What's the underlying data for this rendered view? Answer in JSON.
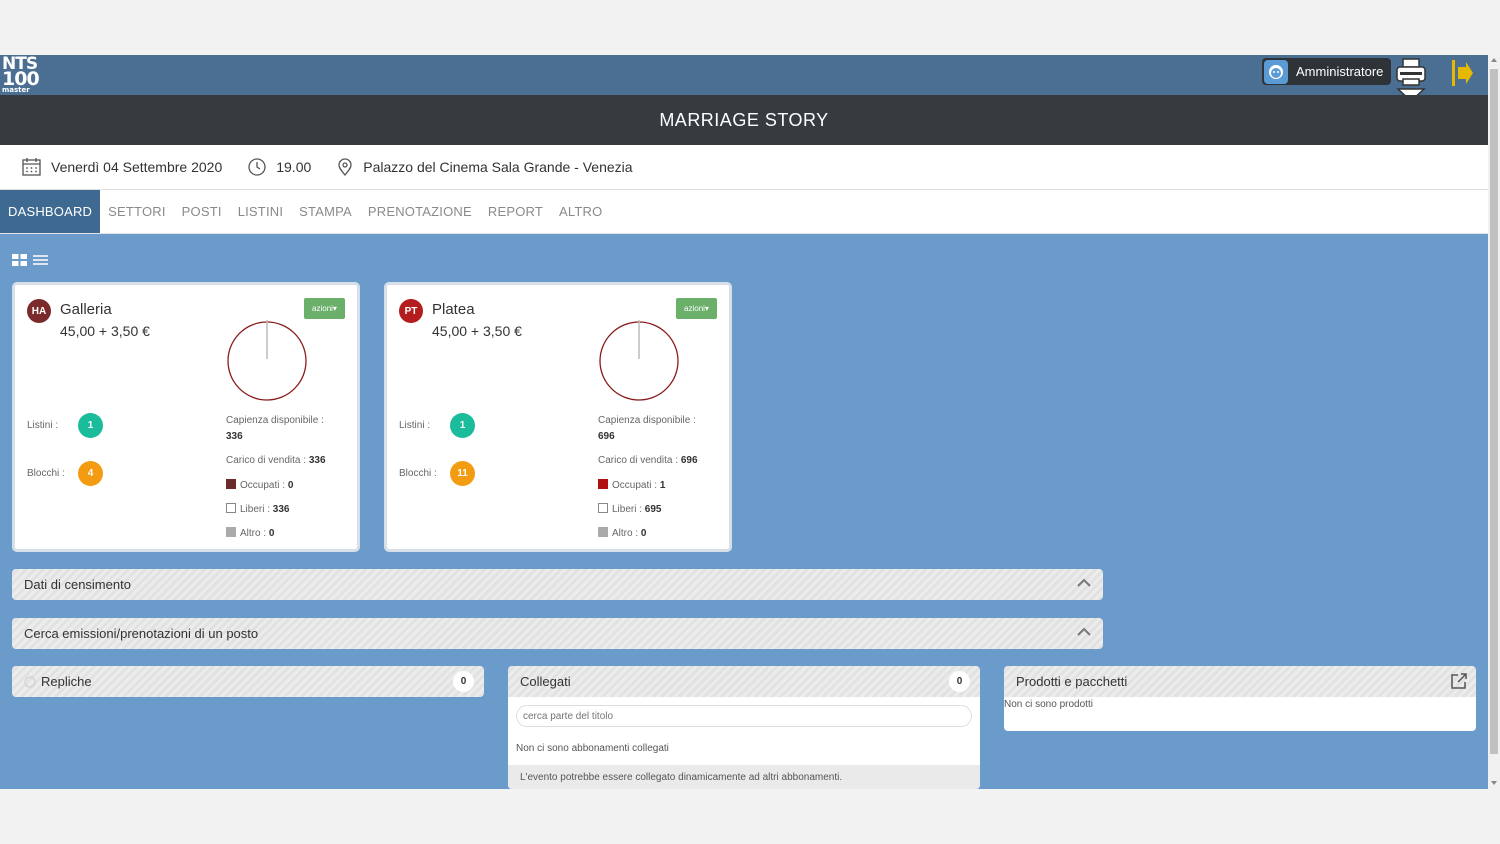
{
  "header": {
    "logo_line1": "NTS",
    "logo_line2": "100",
    "logo_line3": "master",
    "user": "Amministratore"
  },
  "event": {
    "title": "MARRIAGE STORY",
    "date": "Venerdì 04 Settembre 2020",
    "time": "19.00",
    "venue": "Palazzo del Cinema Sala Grande - Venezia"
  },
  "tabs": [
    {
      "label": "DASHBOARD",
      "active": true
    },
    {
      "label": "SETTORI"
    },
    {
      "label": "POSTI"
    },
    {
      "label": "LISTINI"
    },
    {
      "label": "STAMPA"
    },
    {
      "label": "PRENOTAZIONE"
    },
    {
      "label": "REPORT"
    },
    {
      "label": "ALTRO"
    }
  ],
  "sectors": [
    {
      "code": "HA",
      "code_color": "#7a2a2a",
      "name": "Galleria",
      "price": "45,00  + 3,50 €",
      "actions": "azioni▾",
      "listini_label": "Listini :",
      "listini": "1",
      "blocchi_label": "Blocchi :",
      "blocchi": "4",
      "capienza_label": "Capienza disponibile :",
      "capienza": "336",
      "carico_label": "Carico di vendita :",
      "carico": "336",
      "occupati_label": "Occupati :",
      "occupati": "0",
      "occupati_color": "#6b2b2b",
      "liberi_label": "Liberi :",
      "liberi": "336",
      "altro_label": "Altro :",
      "altro": "0",
      "occupied_fraction": 0.0
    },
    {
      "code": "PT",
      "code_color": "#b31d1d",
      "name": "Platea",
      "price": "45,00  + 3,50 €",
      "actions": "azioni▾",
      "listini_label": "Listini :",
      "listini": "1",
      "blocchi_label": "Blocchi :",
      "blocchi": "11",
      "capienza_label": "Capienza disponibile :",
      "capienza": "696",
      "carico_label": "Carico di vendita :",
      "carico": "696",
      "occupati_label": "Occupati :",
      "occupati": "1",
      "occupati_color": "#b01010",
      "liberi_label": "Liberi :",
      "liberi": "695",
      "altro_label": "Altro :",
      "altro": "0",
      "occupied_fraction": 0.0014
    }
  ],
  "panels": {
    "censimento": "Dati di censimento",
    "cerca": "Cerca emissioni/prenotazioni di un posto"
  },
  "repliche": {
    "title": "Repliche",
    "count": "0"
  },
  "collegati": {
    "title": "Collegati",
    "count": "0",
    "search_placeholder": "cerca parte del titolo",
    "empty": "Non ci sono abbonamenti collegati",
    "note": "L'evento potrebbe essere collegato dinamicamente ad altri abbonamenti."
  },
  "prodotti": {
    "title": "Prodotti e pacchetti",
    "empty": "Non ci sono prodotti"
  },
  "colors": {
    "listini": "#1abc9c",
    "blocchi": "#f39c12",
    "azioni": "#6aaf6a",
    "active_tab": "#3e6a92"
  }
}
